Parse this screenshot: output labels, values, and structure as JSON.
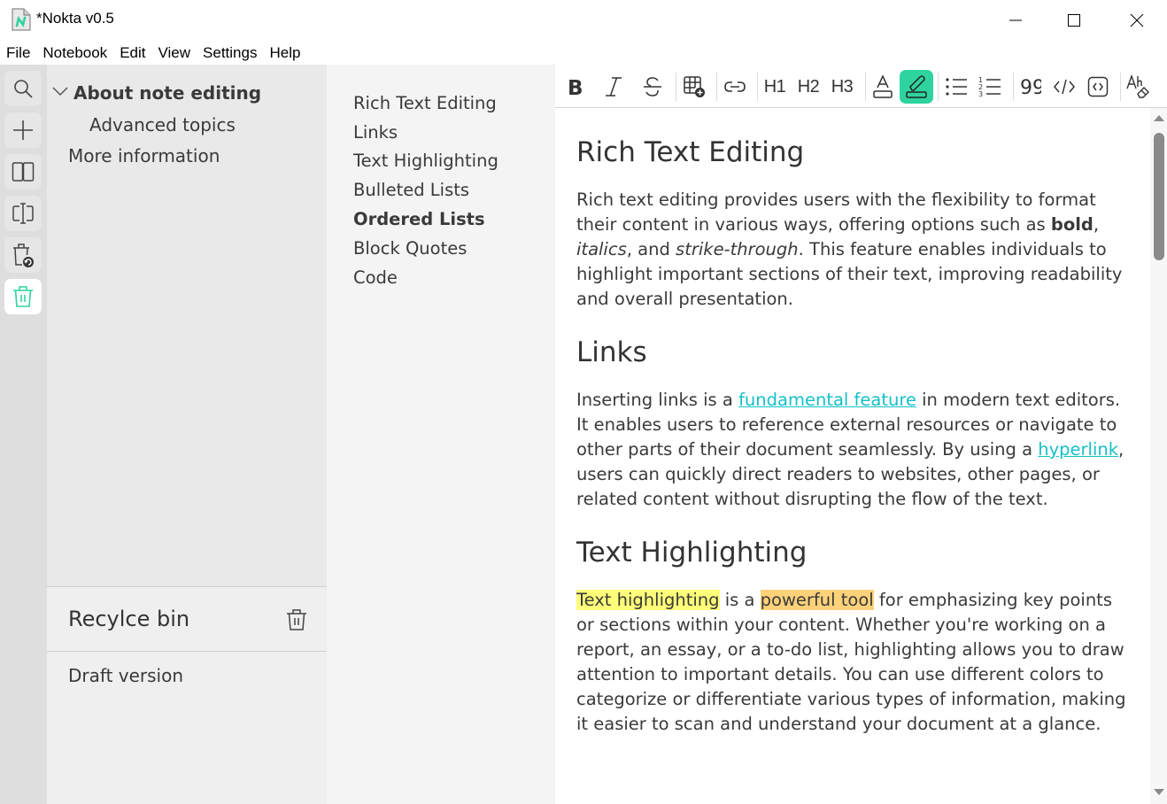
{
  "window": {
    "title": "*Nokta v0.5",
    "app_icon": "nokta-document-icon",
    "controls": [
      "minimize-icon",
      "maximize-icon",
      "close-icon"
    ]
  },
  "menu": [
    "File",
    "Notebook",
    "Edit",
    "View",
    "Settings",
    "Help"
  ],
  "rail": [
    {
      "name": "search",
      "icon": "search-icon"
    },
    {
      "name": "add",
      "icon": "plus-icon"
    },
    {
      "name": "open-book",
      "icon": "book-icon"
    },
    {
      "name": "split-view",
      "icon": "text-cursor-split-icon"
    },
    {
      "name": "restore-bin",
      "icon": "trash-restore-icon"
    },
    {
      "name": "recycle-bin",
      "icon": "trash-icon",
      "active": true
    }
  ],
  "tree": {
    "items": [
      {
        "label": "About note editing",
        "expanded": true,
        "bold": true
      },
      {
        "label": "Advanced topics",
        "indent": 1
      },
      {
        "label": "More information"
      }
    ]
  },
  "recycle_bin": {
    "title": "Recylce bin",
    "items": [
      "Draft version"
    ]
  },
  "outline": {
    "items": [
      "Rich Text Editing",
      "Links",
      "Text Highlighting",
      "Bulleted Lists",
      "Ordered Lists",
      "Block Quotes",
      "Code"
    ],
    "active": "Ordered Lists"
  },
  "toolbar": {
    "buttons": [
      {
        "name": "bold",
        "icon": "bold-icon"
      },
      {
        "name": "italic",
        "icon": "italic-icon"
      },
      {
        "name": "strikethrough",
        "icon": "strikethrough-icon"
      },
      {
        "name": "insert-table",
        "icon": "table-add-icon"
      },
      {
        "name": "link",
        "icon": "link-icon"
      },
      {
        "name": "h1",
        "label": "H1"
      },
      {
        "name": "h2",
        "label": "H2"
      },
      {
        "name": "h3",
        "label": "H3"
      },
      {
        "name": "text-color",
        "icon": "text-color-icon"
      },
      {
        "name": "highlight",
        "icon": "highlighter-icon",
        "active": true
      },
      {
        "name": "bulleted-list",
        "icon": "bulleted-list-icon"
      },
      {
        "name": "ordered-list",
        "icon": "ordered-list-icon"
      },
      {
        "name": "block-quote",
        "icon": "quote-icon"
      },
      {
        "name": "inline-code",
        "icon": "code-icon"
      },
      {
        "name": "code-block",
        "icon": "code-block-icon"
      },
      {
        "name": "clear-format",
        "icon": "clear-format-icon"
      }
    ],
    "active_color": "#2fd39f"
  },
  "document": {
    "sections": [
      {
        "heading": "Rich Text Editing",
        "p_parts": {
          "a": "Rich text editing provides users with the flexibility to format their content in various ways, offering options such as ",
          "bold": "bold",
          "b": ", ",
          "italic": "italics",
          "c": ", and ",
          "strike": "strike-through",
          "d": ". This feature enables individuals to highlight important sections of their text, improving readability and overall presentation."
        }
      },
      {
        "heading": "Links",
        "p_parts": {
          "a": "Inserting links is a ",
          "link1": "fundamental feature",
          "b": " in modern text editors. It enables users to reference external resources or navigate to other parts of their document seamlessly. By using a ",
          "link2": "hyperlink",
          "c": ", users can quickly direct readers to websites, other pages, or related content without disrupting the flow of the text."
        }
      },
      {
        "heading": "Text Highlighting",
        "p_parts": {
          "hl1": "Text highlighting",
          "a": " is a ",
          "hl2": "powerful tool",
          "b": " for emphasizing key points or sections within your content. Whether you're working on a report, an essay, or a to-do list, highlighting allows you to draw attention to important details. You can use different colors to categorize or differentiate various types of information, making it easier to scan and understand your document at a glance."
        }
      }
    ],
    "link_color": "#16c0c8",
    "highlight_colors": [
      "#ffff7a",
      "#ffd27a"
    ]
  }
}
